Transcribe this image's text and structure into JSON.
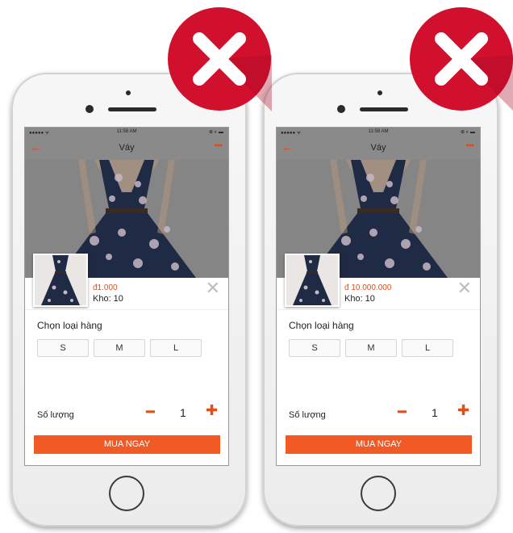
{
  "screens": [
    {
      "status_signal": "●●●●● ᯤ",
      "status_time": "11:58 AM",
      "status_right": "⊕ ◐ ▬",
      "nav_title": "Váy",
      "price": "đ1.000",
      "stock": "Kho: 10",
      "variant_heading": "Chọn loại hàng",
      "size_options": [
        "S",
        "M",
        "L"
      ],
      "quantity_label": "Số lượng",
      "quantity_value": "1",
      "buy_label": "MUA NGAY"
    },
    {
      "status_signal": "●●●●● ᯤ",
      "status_time": "11:58 AM",
      "status_right": "⊕ ◐ ▬",
      "nav_title": "Váy",
      "price": "đ 10.000.000",
      "stock": "Kho: 10",
      "variant_heading": "Chọn loại hàng",
      "size_options": [
        "S",
        "M",
        "L"
      ],
      "quantity_label": "Số lượng",
      "quantity_value": "1",
      "buy_label": "MUA NGAY"
    }
  ],
  "icons": {
    "back": "arrow-left-icon",
    "more": "more-dots-icon",
    "close": "close-icon",
    "minus": "minus-icon",
    "plus": "plus-icon",
    "wrong": "x-mark-icon"
  },
  "colors": {
    "accent": "#f15a24",
    "badge": "#d1102e",
    "dress": "#1f2a44"
  }
}
